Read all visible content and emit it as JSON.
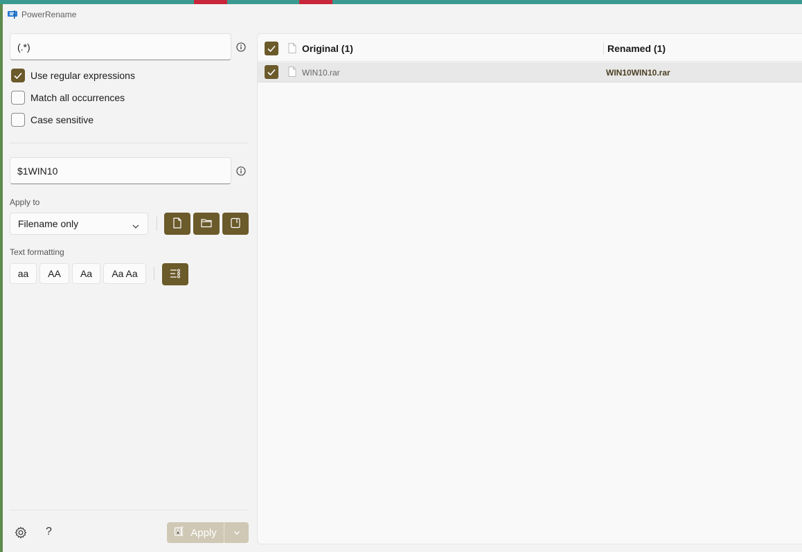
{
  "window": {
    "title": "PowerRename"
  },
  "search": {
    "value": "(.*)"
  },
  "options": [
    {
      "label": "Use regular expressions",
      "checked": true
    },
    {
      "label": "Match all occurrences",
      "checked": false
    },
    {
      "label": "Case sensitive",
      "checked": false
    }
  ],
  "replace": {
    "value": "$1WIN10"
  },
  "apply_to": {
    "label": "Apply to",
    "selected": "Filename only",
    "buttons": [
      "include-files-icon",
      "include-folders-icon",
      "include-subfolders-icon"
    ]
  },
  "text_formatting": {
    "label": "Text formatting",
    "buttons": [
      "aa",
      "AA",
      "Aa",
      "Aa Aa"
    ],
    "enumerate_icon": "enumerate-items-icon"
  },
  "footer": {
    "help": "?",
    "apply_label": "Apply"
  },
  "files": {
    "original_header": "Original (1)",
    "renamed_header": "Renamed (1)",
    "rows": [
      {
        "original": "WIN10.rar",
        "renamed": "WIN10WIN10.rar",
        "checked": true
      }
    ]
  },
  "colors": {
    "accent": "#6b5a2a",
    "window_bg": "#f3f3f3"
  }
}
